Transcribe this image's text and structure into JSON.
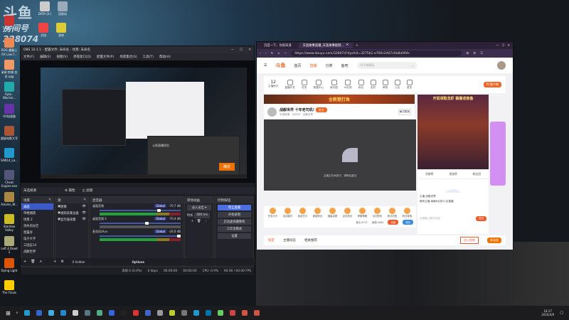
{
  "desktop": {
    "overlay": {
      "line1": "斗鱼",
      "line2": "房间号",
      "line3": "328074"
    },
    "icons": [
      {
        "label": "Tyson 2..."
      },
      {
        "label": "ROG 魔霸士 RX Low F..."
      },
      {
        "label": "录屏·剪辑 加花.ogg"
      },
      {
        "label": "Ryto - Warrior..."
      },
      {
        "label": "UU加速器"
      },
      {
        "label": "超级电影大亨"
      },
      {
        "label": "SAN14_La..."
      },
      {
        "label": "Cheat Engine.exe"
      },
      {
        "label": "Aslains_W..."
      },
      {
        "label": "Stardew Valley"
      },
      {
        "label": "Left 4 Dead 2"
      },
      {
        "label": "Dying Light"
      },
      {
        "label": "The Finals"
      }
    ],
    "top_icons": [
      {
        "label": "DATA (E:)"
      },
      {
        "label": "回收站"
      },
      {
        "label": "文档"
      },
      {
        "label": "游戏"
      }
    ]
  },
  "obs": {
    "title": "OBS 32.1.1 - 配置文件: 未命名 - 场景: 未命名",
    "menu": [
      "文件(F)",
      "编辑(E)",
      "视图(V)",
      "停靠窗口(D)",
      "配置文件(P)",
      "场景集合(S)",
      "工具(T)",
      "帮助(H)"
    ],
    "preview_dialog": {
      "text": "斗鱼直播伴侣",
      "button": "确定"
    },
    "no_source": "未选择源",
    "props": "属性",
    "filters": "滤镜",
    "scenes": {
      "title": "场景",
      "items": [
        "桌面",
        "带棍烟夜",
        "场景 2",
        "消失的光芒",
        "星露谷",
        "电子大亨",
        "三国志14",
        "战舰世界"
      ],
      "selected": 0
    },
    "sources": {
      "title": "源",
      "items": [
        "图像",
        "视频采集设备",
        "显示器采集"
      ]
    },
    "mixer": {
      "title": "混音器",
      "channels": [
        {
          "name": "桌面音频",
          "badge": "Global",
          "db": "-70.7 dB",
          "volume": 0.75,
          "muted": false
        },
        {
          "name": "桌面音频 2",
          "badge": "Global",
          "db": "-70.4 dB",
          "volume": 0.6,
          "muted": true
        },
        {
          "name": "麦克风/Aux",
          "badge": "Global",
          "db": "-26.0 dB",
          "volume": 1.0,
          "muted": false
        }
      ],
      "hidden": "0 hidden",
      "options": "Options"
    },
    "transitions": {
      "title": "转场动画",
      "type": "淡入淡出",
      "duration_label": "时长",
      "duration": "300 ms"
    },
    "controls": {
      "title": "控制按钮",
      "buttons": [
        "停止直播",
        "开始录制",
        "启动虚拟摄像机",
        "工作室模式",
        "设置"
      ]
    },
    "status": {
      "dropped": "丢帧 0 (0.0%)",
      "kbps": "0 kbps",
      "stream_time": "00:00:00",
      "rec_time": "00:00:00",
      "cpu": "CPU: 0.9%",
      "fps": "60.00 / 60.00 FPS"
    }
  },
  "browser": {
    "tabs": [
      {
        "label": "百度一下，你就知道"
      },
      {
        "label": "天涯故事直播_天涯故事视频..."
      }
    ],
    "url": "https://www.douyu.com/328074?dyshid=3275b1-a760c2d07c0e8a094c",
    "page": {
      "logo": "斗鱼",
      "nav": [
        "首页",
        "直播",
        "分类",
        "鱼吧"
      ],
      "active_nav": "直播",
      "search_placeholder": "好不够精彩",
      "subnav": [
        {
          "label": "主播积分",
          "value": "12"
        },
        {
          "label": "直播开关"
        },
        {
          "label": "任务"
        },
        {
          "label": "数据中心"
        },
        {
          "label": "鱼乐园"
        },
        {
          "label": "AI礼物"
        },
        {
          "label": "粉丝"
        },
        {
          "label": "定时"
        },
        {
          "label": "审核"
        },
        {
          "label": "公告"
        },
        {
          "label": "更多"
        }
      ],
      "pc_client": "PC客户端",
      "banner": "全新楚打鱼",
      "ad": "开局领取龙虾 躺着收装备",
      "streamer": {
        "title": "战舰世界 十年老司机!",
        "follow": "关注",
        "name": "天涯故事",
        "heat": "49859",
        "category": "战舰世界",
        "checkin": "每日签到"
      },
      "player_msg": "主播正在休息中，请稍后重试",
      "gifts": [
        "任务大厅",
        "欢迎模式",
        "免费白卡",
        "超能粉丝",
        "福星高照",
        "钻石粉丝",
        "荣耀神殿",
        "互动预言",
        "粉丝钓鱼",
        "粉丝家族"
      ],
      "fish": "鱼丸 6737",
      "fishball": "鱼翅 4063",
      "recharge": "充值",
      "back": "背包",
      "side_tabs": [
        "贡献榜",
        "贵族榜",
        "粉丝团"
      ],
      "side_empty": "近点亮粉丝上榜",
      "chat": {
        "anchor": "主播 战舰世界",
        "notice": "佛系主播 每晚6点到11点直播",
        "placeholder": "这里输入聊天内容",
        "send": "发送"
      },
      "bottom_tabs": [
        "指定",
        "主播动态",
        "相关推荐"
      ],
      "enter_bar": "进入鱼吧",
      "post": "发动态"
    }
  },
  "taskbar": {
    "time": "18:27",
    "date": "2024/4/6"
  }
}
